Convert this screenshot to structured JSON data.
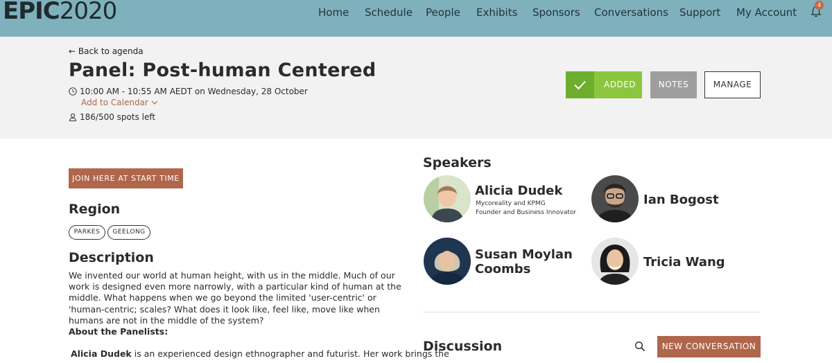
{
  "brand": {
    "logo_bold": "EPIC",
    "logo_light": "2020"
  },
  "nav": {
    "items": [
      "Home",
      "Schedule",
      "People",
      "Exhibits",
      "Sponsors",
      "Conversations",
      "Support",
      "My Account"
    ],
    "notification_count": "4"
  },
  "event": {
    "back_label": "Back to agenda",
    "title": "Panel: Post-human Centered",
    "time": "10:00 AM - 10:55 AM AEDT on Wednesday, 28 October",
    "add_to_calendar": "Add to Calendar",
    "spots": "186/500 spots left",
    "buttons": {
      "added": "ADDED",
      "notes": "NOTES",
      "manage": "MANAGE"
    }
  },
  "join_button": "JOIN HERE AT START TIME",
  "region": {
    "heading": "Region",
    "tags": [
      "PARKES",
      "GEELONG"
    ]
  },
  "description": {
    "heading": "Description",
    "text": "We invented our world at human height, with us in the middle. Much of our work is designed even more narrowly, with a particular kind of human at the middle. What happens when we go beyond the limited 'user-centric' or 'human-centric; scales? What does it look like, feel like, move like when humans are not in the middle of the system?",
    "about_heading": "About the Panelists:",
    "bio_name": "Alicia Dudek",
    "bio_text": " is an experienced design ethnographer and futurist. Her work brings the"
  },
  "speakers": {
    "heading": "Speakers",
    "list": [
      {
        "name": "Alicia Dudek",
        "subtitle_1": "Mycoreality and KPMG",
        "subtitle_2": "Founder and Business Innovator"
      },
      {
        "name": "Ian Bogost"
      },
      {
        "name_line_1": "Susan Moylan",
        "name_line_2": "Coombs"
      },
      {
        "name": "Tricia Wang"
      }
    ]
  },
  "discussion": {
    "heading": "Discussion",
    "new_button": "NEW CONVERSATION"
  },
  "colors": {
    "nav_bg": "#7fb1bd",
    "accent": "#b0664b",
    "added_green": "#8cc63f",
    "notes_grey": "#9e9e9e"
  }
}
